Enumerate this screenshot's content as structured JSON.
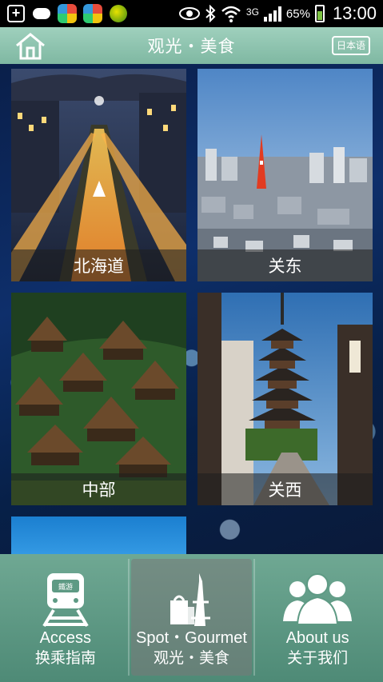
{
  "status_bar": {
    "network": "3G",
    "battery": "65%",
    "time": "13:00"
  },
  "header": {
    "title": "观光・美食",
    "lang_button": "日本语"
  },
  "regions": [
    {
      "label": "北海道"
    },
    {
      "label": "关东"
    },
    {
      "label": "中部"
    },
    {
      "label": "关西"
    }
  ],
  "bottom_nav": [
    {
      "label_en": "Access",
      "label_cn": "换乘指南",
      "active": false
    },
    {
      "label_en": "Spot・Gourmet",
      "label_cn": "观光・美食",
      "active": true
    },
    {
      "label_en": "About us",
      "label_cn": "关于我们",
      "active": false
    }
  ],
  "colors": {
    "header": "#8cc4ae",
    "nav": "#5e9a84",
    "main_bg": "#0e2f6b"
  }
}
